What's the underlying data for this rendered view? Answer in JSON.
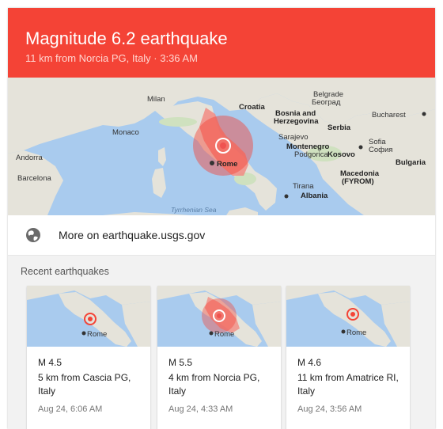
{
  "header": {
    "title": "Magnitude 6.2 earthquake",
    "subtitle": "11 km from Norcia PG, Italy · 3:36 AM",
    "color": "#f44336"
  },
  "map": {
    "cities": [
      "Milan",
      "Monaco",
      "Andorra",
      "Barcelona",
      "Rome",
      "Croatia",
      "Belgrade",
      "Београд",
      "Bucharest",
      "Bosnia and",
      "Herzegovina",
      "Sarajevo",
      "Serbia",
      "Montenegro",
      "Podgorica",
      "Kosovo",
      "Sofia",
      "София",
      "Bulgaria",
      "Tirana",
      "Albania",
      "Macedonia",
      "(FYROM)"
    ],
    "sea_label": "Tyrrhenian Sea"
  },
  "link": {
    "icon": "globe-icon",
    "label": "More on earthquake.usgs.gov"
  },
  "recent": {
    "title": "Recent earthquakes",
    "items": [
      {
        "magnitude": "M 4.5",
        "location": "5 km from Cascia PG, Italy",
        "date": "Aug 24, 6:06 AM",
        "city": "Rome",
        "large": false
      },
      {
        "magnitude": "M 5.5",
        "location": "4 km from Norcia PG, Italy",
        "date": "Aug 24, 4:33 AM",
        "city": "Rome",
        "large": true
      },
      {
        "magnitude": "M 4.6",
        "location": "11 km from Amatrice RI, Italy",
        "date": "Aug 24, 3:56 AM",
        "city": "Rome",
        "large": false
      }
    ]
  }
}
